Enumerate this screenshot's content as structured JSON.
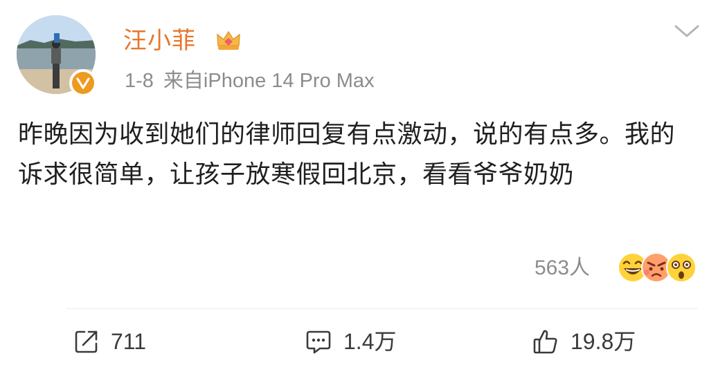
{
  "user": {
    "name": "汪小菲",
    "date": "1-8",
    "source": "来自iPhone 14 Pro Max",
    "badge_icon": "verified-v-icon",
    "badge_color": "#ee9a1e",
    "vip_icon": "crown-icon"
  },
  "post": {
    "text": "昨晚因为收到她们的律师回复有点激动，说的有点多。我的诉求很简单，让孩子放寒假回北京，看看爷爷奶奶"
  },
  "reactions": {
    "count": "563人",
    "emoji_icons": [
      "laughing-emoji-icon",
      "angry-emoji-icon",
      "surprised-emoji-icon"
    ]
  },
  "actions": {
    "repost": "711",
    "comment": "1.4万",
    "like": "19.8万"
  },
  "colors": {
    "username": "#e8762b",
    "meta": "#8c8c8c",
    "text": "#1f1f1f",
    "action": "#3a3a3a"
  }
}
